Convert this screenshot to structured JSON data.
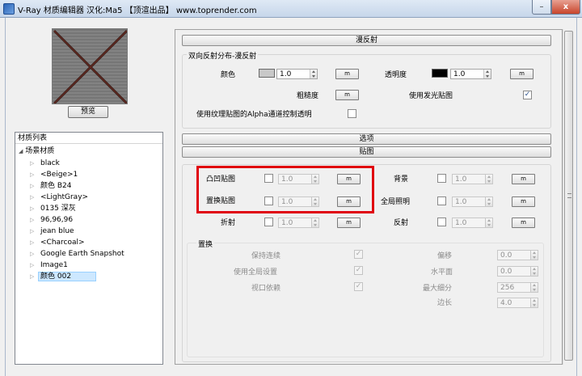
{
  "window": {
    "title": "V-Ray 材质编辑器    汉化:Ma5    【顶渲出品】 www.toprender.com",
    "minimize_glyph": "–",
    "close_glyph": "x"
  },
  "preview": {
    "button_label": "预览"
  },
  "material_list": {
    "header": "材质列表",
    "root_label": "场景材质",
    "items": [
      {
        "label": "black"
      },
      {
        "label": "<Beige>1"
      },
      {
        "label": "颜色 B24"
      },
      {
        "label": "<LightGray>"
      },
      {
        "label": "0135 深灰"
      },
      {
        "label": "96,96,96"
      },
      {
        "label": "jean blue"
      },
      {
        "label": "<Charcoal>"
      },
      {
        "label": "Google Earth Snapshot"
      },
      {
        "label": "Image1"
      },
      {
        "label": "颜色 002",
        "selected": true
      }
    ]
  },
  "diffuse": {
    "section_title": "漫反射",
    "group_title": "双向反射分布-漫反射",
    "color_label": "颜色",
    "color_swatch": "#c8c8c8",
    "color_value": "1.0",
    "transparency_label": "透明度",
    "transparency_swatch": "#000000",
    "transparency_value": "1.0",
    "roughness_label": "粗糙度",
    "use_illum_map_label": "使用发光贴图",
    "use_illum_map_checked": true,
    "alpha_label": "使用纹理贴图的Alpha通道控制透明",
    "map_button": "m"
  },
  "options": {
    "section_title": "选项"
  },
  "maps": {
    "section_title": "贴图",
    "bump_label": "凸凹贴图",
    "bump_value": "1.0",
    "displacement_label": "置换贴图",
    "displacement_value": "1.0",
    "refraction_label": "折射",
    "refraction_value": "1.0",
    "background_label": "背景",
    "background_value": "1.0",
    "gi_label": "全局照明",
    "gi_value": "1.0",
    "reflection_label": "反射",
    "reflection_value": "1.0",
    "map_button": "m"
  },
  "displacement_settings": {
    "group_title": "置换",
    "keep_continuity_label": "保持连续",
    "use_global_label": "使用全局设置",
    "view_dependent_label": "视口依赖",
    "offset_label": "偏移",
    "offset_value": "0.0",
    "water_level_label": "水平面",
    "water_level_value": "0.0",
    "max_subdiv_label": "最大细分",
    "max_subdiv_value": "256",
    "edge_length_label": "边长",
    "edge_length_value": "4.0",
    "check_glyph": "✓"
  },
  "colors": {
    "highlight": "#e0000e",
    "selection": "#cde8ff"
  }
}
